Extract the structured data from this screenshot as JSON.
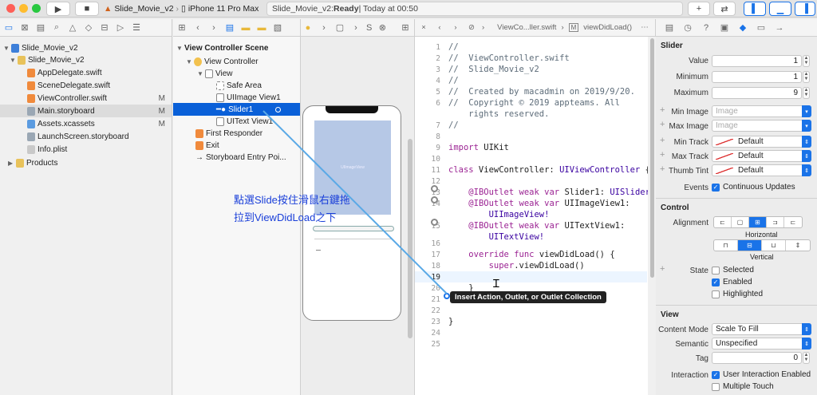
{
  "toolbar": {
    "scheme": "Slide_Movie_v2",
    "device": "iPhone 11 Pro Max",
    "status_project": "Slide_Movie_v2: ",
    "status_state": "Ready",
    "status_time": " | Today at 00:50"
  },
  "navigator": {
    "project": "Slide_Movie_v2",
    "group": "Slide_Movie_v2",
    "files": [
      {
        "name": "AppDelegate.swift",
        "mark": ""
      },
      {
        "name": "SceneDelegate.swift",
        "mark": ""
      },
      {
        "name": "ViewController.swift",
        "mark": "M"
      },
      {
        "name": "Main.storyboard",
        "mark": "M"
      },
      {
        "name": "Assets.xcassets",
        "mark": "M"
      },
      {
        "name": "LaunchScreen.storyboard",
        "mark": ""
      },
      {
        "name": "Info.plist",
        "mark": ""
      }
    ],
    "products": "Products"
  },
  "outline": {
    "scene": "View Controller Scene",
    "items": [
      "View Controller",
      "View",
      "Safe Area",
      "UIImage View1",
      "Slider1",
      "UIText View1",
      "First Responder",
      "Exit",
      "Storyboard Entry Poi..."
    ]
  },
  "canvas": {
    "image_caption": "UIImageView"
  },
  "editor": {
    "jump_file": "ViewCo...ller.swift",
    "jump_symbol": "viewDidLoad()",
    "tooltip": "Insert Action, Outlet, or Outlet Collection",
    "breadcrumb_tail": "S"
  },
  "annotation": {
    "line1": "點選Slide按住滑鼠右鍵拖",
    "line2": "拉到ViewDidLoad之下"
  },
  "inspector": {
    "slider_title": "Slider",
    "value_label": "Value",
    "value": "1",
    "minimum_label": "Minimum",
    "minimum": "1",
    "maximum_label": "Maximum",
    "maximum": "9",
    "min_image_label": "Min Image",
    "min_image_ph": "Image",
    "max_image_label": "Max Image",
    "max_image_ph": "Image",
    "min_track_label": "Min Track",
    "min_track": "Default",
    "max_track_label": "Max Track",
    "max_track": "Default",
    "thumb_tint_label": "Thumb Tint",
    "thumb_tint": "Default",
    "events_label": "Events",
    "continuous": "Continuous Updates",
    "control_title": "Control",
    "alignment_label": "Alignment",
    "horizontal": "Horizontal",
    "vertical": "Vertical",
    "state_label": "State",
    "selected": "Selected",
    "enabled": "Enabled",
    "highlighted": "Highlighted",
    "view_title": "View",
    "content_mode_label": "Content Mode",
    "content_mode": "Scale To Fill",
    "semantic_label": "Semantic",
    "semantic": "Unspecified",
    "tag_label": "Tag",
    "tag": "0",
    "interaction_label": "Interaction",
    "user_interaction": "User Interaction Enabled",
    "multiple_touch": "Multiple Touch"
  },
  "colors": {
    "selection": "#0a60d8",
    "accent": "#1a73e8",
    "connection": "#5aa9e6"
  }
}
